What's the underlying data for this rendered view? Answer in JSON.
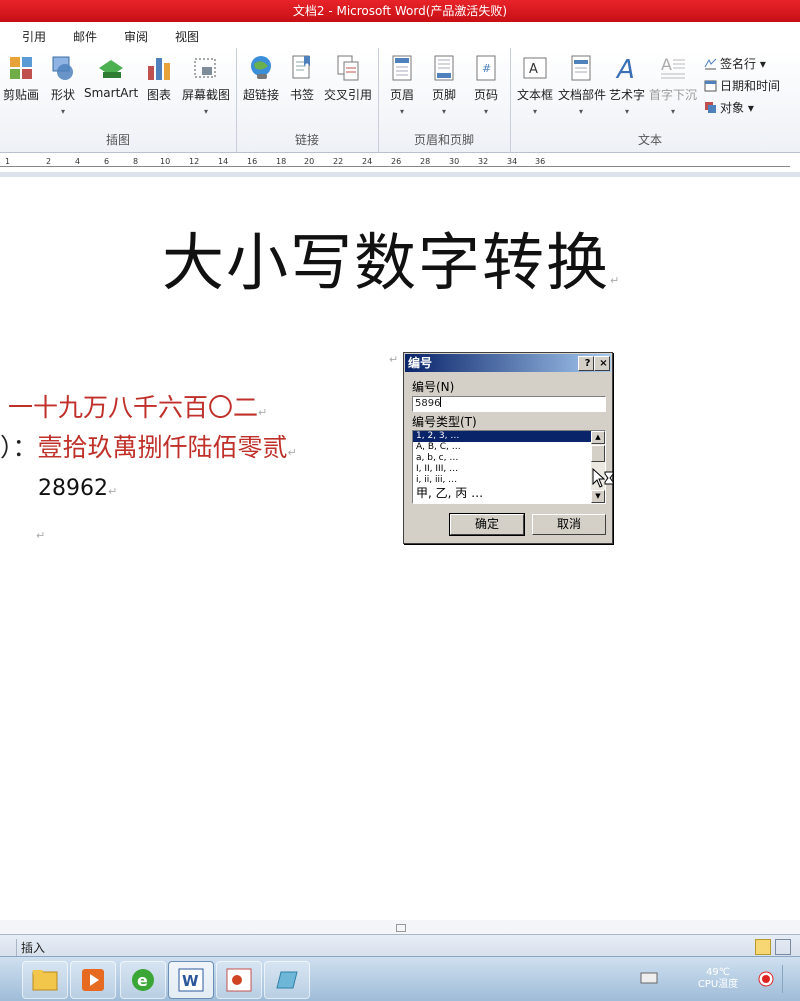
{
  "window": {
    "title": "文档2 - Microsoft Word(产品激活失败)"
  },
  "menu_tabs": [
    "引用",
    "邮件",
    "审阅",
    "视图"
  ],
  "ribbon": {
    "illustrations": {
      "label": "插图",
      "buttons": [
        {
          "label": "剪贴画",
          "icon": "clipart-icon"
        },
        {
          "label": "形状",
          "icon": "shapes-icon"
        },
        {
          "label": "SmartArt",
          "icon": "smartart-icon"
        },
        {
          "label": "图表",
          "icon": "chart-icon"
        },
        {
          "label": "屏幕截图",
          "icon": "screenshot-icon"
        }
      ]
    },
    "links": {
      "label": "链接",
      "buttons": [
        {
          "label": "超链接",
          "icon": "hyperlink-icon"
        },
        {
          "label": "书签",
          "icon": "bookmark-icon"
        },
        {
          "label": "交叉引用",
          "icon": "cross-reference-icon"
        }
      ]
    },
    "header_footer": {
      "label": "页眉和页脚",
      "buttons": [
        {
          "label": "页眉",
          "icon": "header-icon"
        },
        {
          "label": "页脚",
          "icon": "footer-icon"
        },
        {
          "label": "页码",
          "icon": "page-number-icon"
        }
      ]
    },
    "text": {
      "label": "文本",
      "buttons": [
        {
          "label": "文本框",
          "icon": "textbox-icon"
        },
        {
          "label": "文档部件",
          "icon": "quick-parts-icon"
        },
        {
          "label": "艺术字",
          "icon": "wordart-icon"
        },
        {
          "label": "首字下沉",
          "icon": "dropcap-icon"
        }
      ],
      "small_buttons": [
        {
          "label": "签名行 ▾",
          "icon": "signature-line-icon"
        },
        {
          "label": "日期和时间",
          "icon": "date-time-icon"
        },
        {
          "label": "对象 ▾",
          "icon": "object-icon"
        }
      ]
    }
  },
  "ruler": {
    "ticks": [
      "1",
      "2",
      "4",
      "6",
      "8",
      "10",
      "12",
      "14",
      "16",
      "18",
      "20",
      "22",
      "24",
      "26",
      "28",
      "30",
      "32",
      "34",
      "36"
    ]
  },
  "document": {
    "title": "大小写数字转换",
    "lines": {
      "chinese_lowercase": "一十九万八千六百〇二",
      "line2_prefix": "）：",
      "chinese_uppercase": "壹拾玖萬捌仟陆佰零贰",
      "number": "28962"
    },
    "paragraph_mark": "↵"
  },
  "dialog": {
    "title": "编号",
    "help_button": "?",
    "close_button": "×",
    "number_label": "编号(N)",
    "number_value": "5896",
    "type_label": "编号类型(T)",
    "options": [
      "1, 2, 3, …",
      "A, B, C, …",
      "a, b, c, …",
      "I, II, III, …",
      "i, ii, iii, …",
      "甲, 乙, 丙 …"
    ],
    "selected_index": 0,
    "ok_button": "确定",
    "cancel_button": "取消"
  },
  "status_bar": {
    "mode": "插入"
  },
  "tray": {
    "temperature": "49℃",
    "temp_label": "CPU温度"
  },
  "colors": {
    "title_red": "#d41a20",
    "text_red": "#c0302a",
    "selection": "#0a246a"
  }
}
